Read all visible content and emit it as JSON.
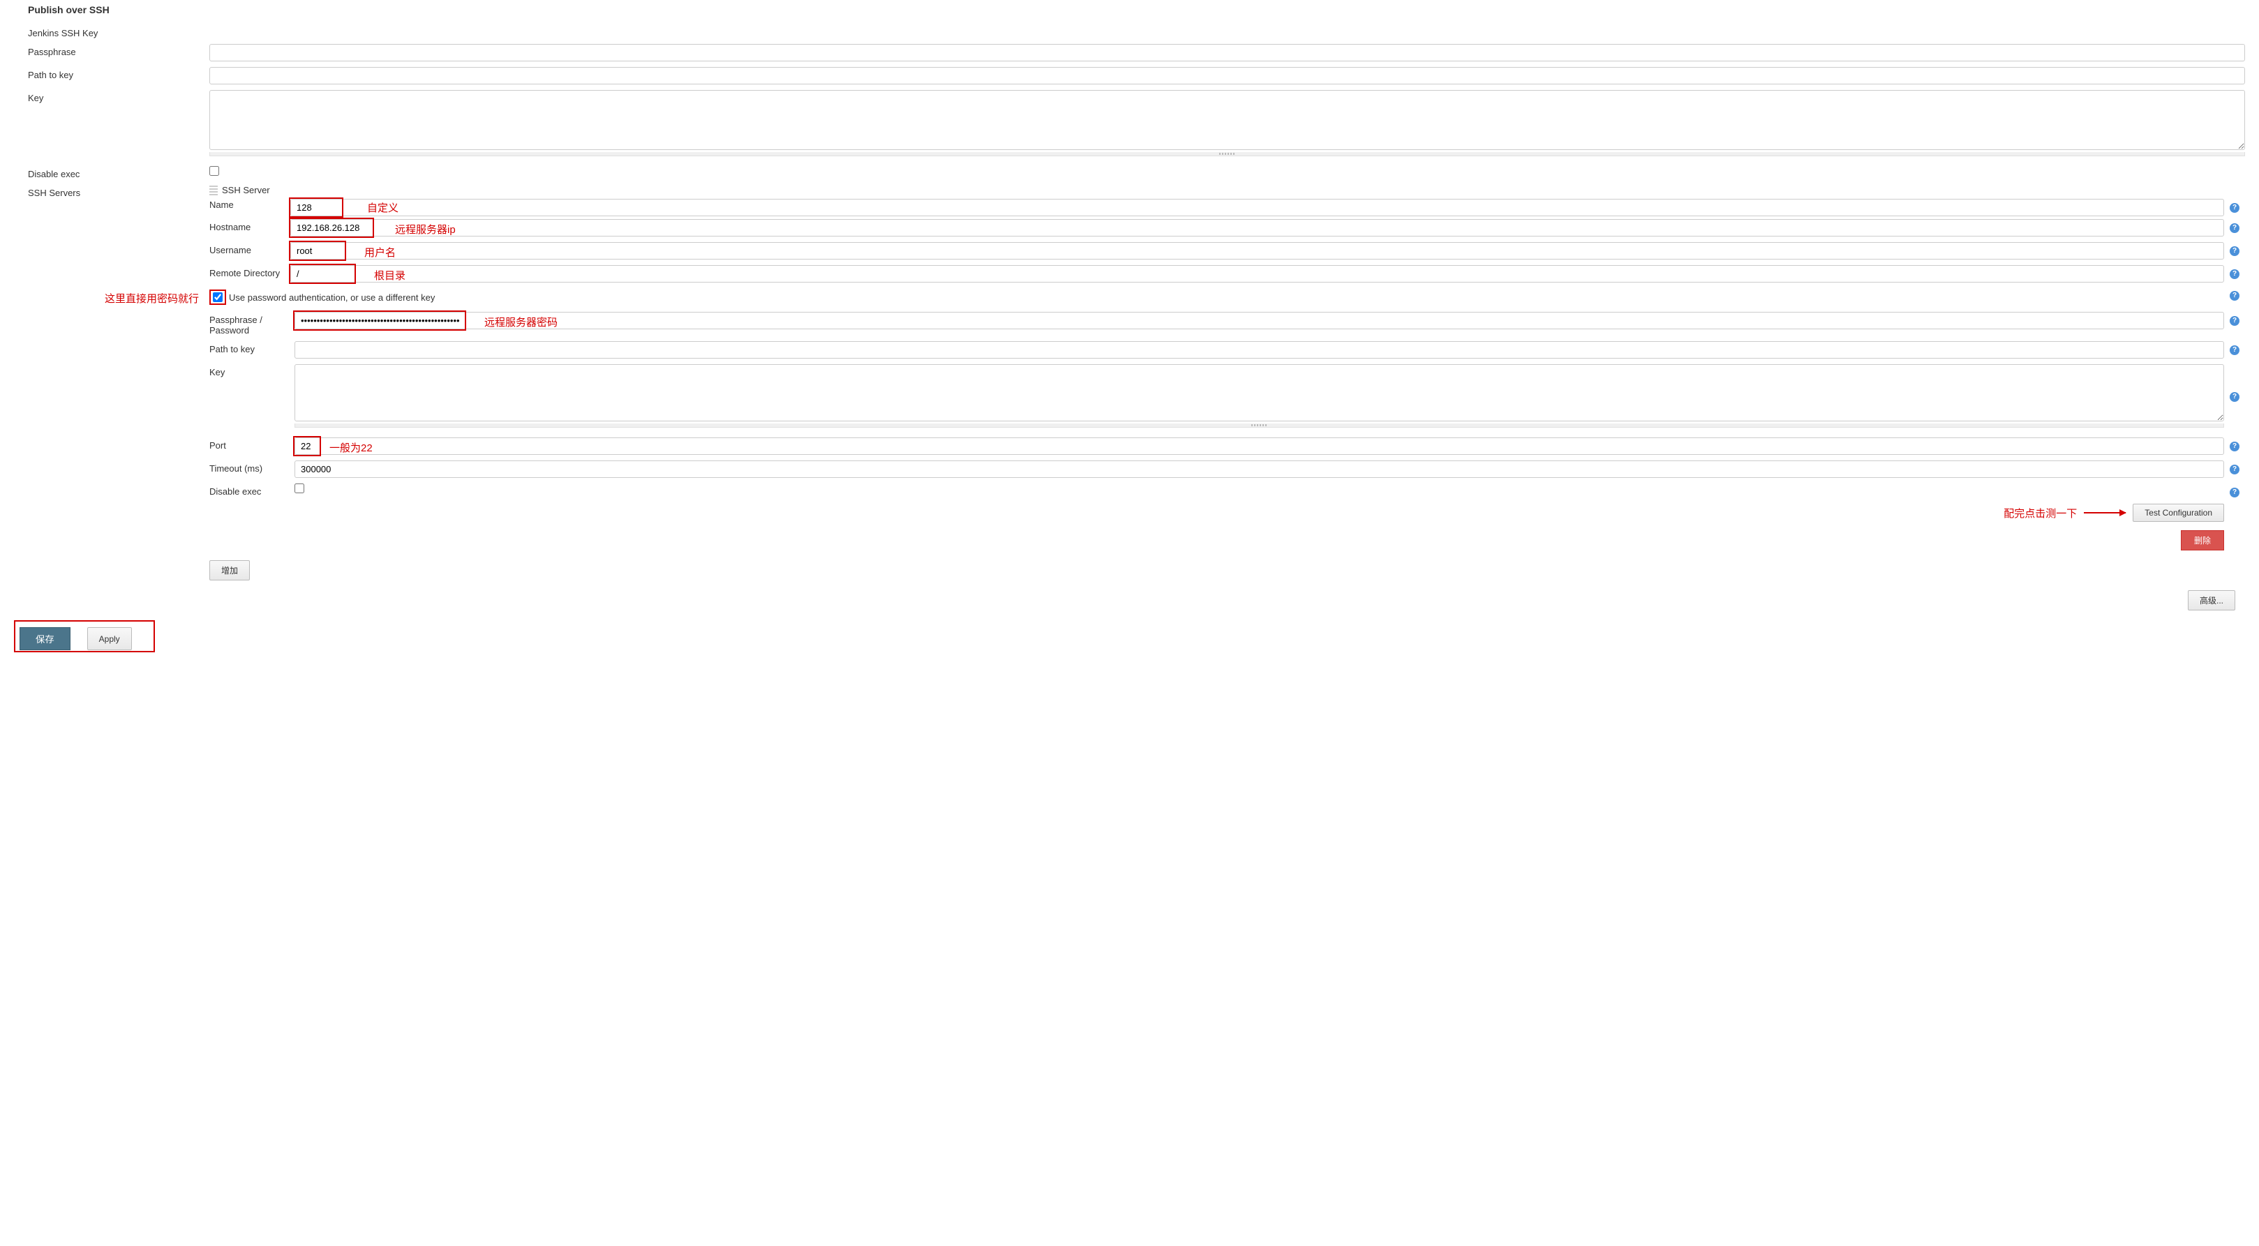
{
  "section_title": "Publish over SSH",
  "top": {
    "jenkins_ssh_key": "Jenkins SSH Key",
    "passphrase_label": "Passphrase",
    "passphrase_value": "",
    "path_to_key_label": "Path to key",
    "path_to_key_value": "",
    "key_label": "Key",
    "key_value": "",
    "disable_exec_label": "Disable exec",
    "ssh_servers_label": "SSH Servers"
  },
  "server": {
    "header_label": "SSH Server",
    "name_label": "Name",
    "name_value": "128",
    "name_anno": "自定义",
    "hostname_label": "Hostname",
    "hostname_value": "192.168.26.128",
    "hostname_anno": "远程服务器ip",
    "username_label": "Username",
    "username_value": "root",
    "username_anno": "用户名",
    "remote_dir_label": "Remote Directory",
    "remote_dir_value": "/",
    "remote_dir_anno": "根目录",
    "use_pw_anno": "这里直接用密码就行",
    "use_pw_label": "Use password authentication, or use a different key",
    "pw_label": "Passphrase / Password",
    "pw_value": "••••••••••••••••••••••••••••••••••••••••••••••••••",
    "pw_anno": "远程服务器密码",
    "path_to_key2_label": "Path to key",
    "path_to_key2_value": "",
    "key2_label": "Key",
    "key2_value": "",
    "port_label": "Port",
    "port_value": "22",
    "port_anno": "一般为22",
    "timeout_label": "Timeout (ms)",
    "timeout_value": "300000",
    "disable_exec2_label": "Disable exec"
  },
  "buttons": {
    "test_config": "Test Configuration",
    "test_config_anno": "配完点击测一下",
    "delete": "删除",
    "add": "增加",
    "advanced": "高级...",
    "save": "保存",
    "apply": "Apply"
  }
}
